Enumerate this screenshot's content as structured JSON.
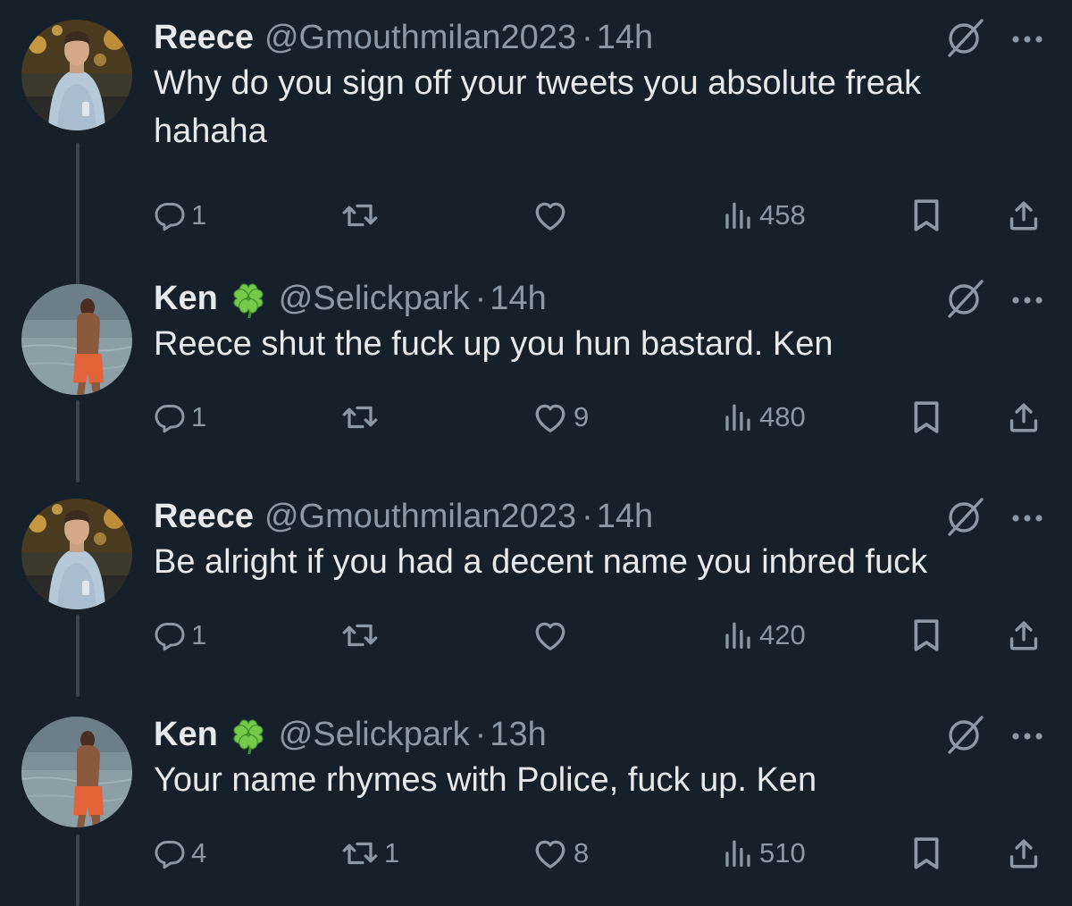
{
  "tweets": [
    {
      "author": "Reece",
      "handle": "@Gmouthmilan2023",
      "separator": "·",
      "time": "14h",
      "text": "Why do you sign off your tweets you absolute freak hahaha",
      "has_emoji": false,
      "replies": "1",
      "retweets": "",
      "likes": "",
      "views": "458"
    },
    {
      "author": "Ken",
      "handle": "@Selickpark",
      "separator": "·",
      "time": "14h",
      "text": "Reece shut the fuck up you hun bastard. Ken",
      "has_emoji": true,
      "replies": "1",
      "retweets": "",
      "likes": "9",
      "views": "480"
    },
    {
      "author": "Reece",
      "handle": "@Gmouthmilan2023",
      "separator": "·",
      "time": "14h",
      "text": "Be alright if you had a decent name you inbred fuck",
      "has_emoji": false,
      "replies": "1",
      "retweets": "",
      "likes": "",
      "views": "420"
    },
    {
      "author": "Ken",
      "handle": "@Selickpark",
      "separator": "·",
      "time": "13h",
      "text": "Your name rhymes with Police, fuck up. Ken",
      "has_emoji": true,
      "replies": "4",
      "retweets": "1",
      "likes": "8",
      "views": "510"
    }
  ],
  "icons": {
    "reply": "reply-icon",
    "retweet": "retweet-icon",
    "like": "heart-icon",
    "views": "views-icon",
    "bookmark": "bookmark-icon",
    "share": "share-icon",
    "grok": "grok-icon",
    "more": "more-icon",
    "emoji": "shamrock-emoji"
  },
  "colors": {
    "background": "#15202b",
    "text": "#e7e9ea",
    "secondary": "#8b98a5",
    "thread_line": "#38444d"
  }
}
